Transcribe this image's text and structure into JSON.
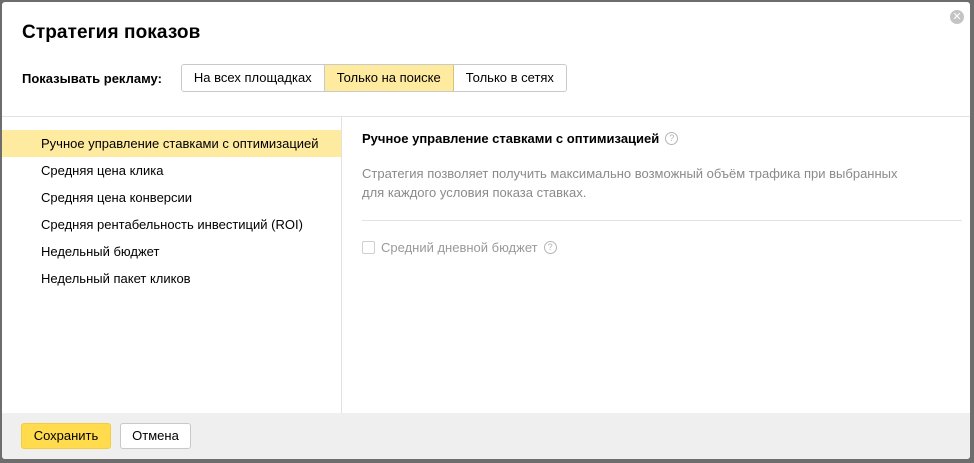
{
  "dialog": {
    "title": "Стратегия показов",
    "close_icon": "close-icon",
    "close_glyph": "✕"
  },
  "show_ads": {
    "label": "Показывать рекламу:",
    "options": [
      "На всех площадках",
      "Только на поиске",
      "Только в сетях"
    ],
    "selected_index": 1
  },
  "strategies": {
    "items": [
      "Ручное управление ставками с оптимизацией",
      "Средняя цена клика",
      "Средняя цена конверсии",
      "Средняя рентабельность инвестиций (ROI)",
      "Недельный бюджет",
      "Недельный пакет кликов"
    ],
    "selected_index": 0
  },
  "content": {
    "title": "Ручное управление ставками с оптимизацией",
    "help_glyph": "?",
    "description": "Стратегия позволяет получить максимально возможный объём трафика при выбранных для каждого условия показа ставках.",
    "daily_budget_label": "Средний дневной бюджет",
    "daily_budget_checked": false
  },
  "footer": {
    "save_label": "Сохранить",
    "cancel_label": "Отмена"
  },
  "colors": {
    "accent_yellow": "#ffdb4d",
    "selected_bg": "#ffeba0",
    "footer_bg": "#efefef"
  }
}
